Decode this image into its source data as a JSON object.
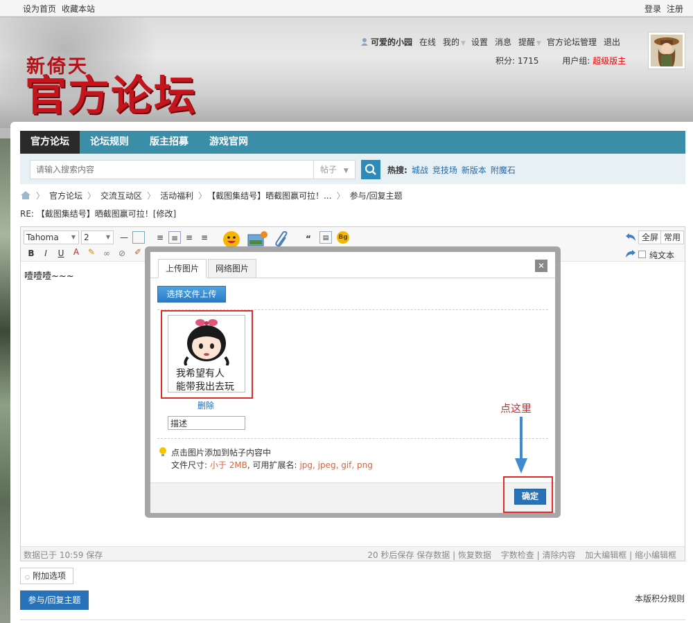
{
  "topbar": {
    "set_home": "设为首页",
    "bookmark": "收藏本站",
    "login": "登录",
    "register": "注册"
  },
  "logo": {
    "small": "新倚天",
    "big": "官方论坛"
  },
  "user": {
    "name": "可爱的小园",
    "status": "在线",
    "mine": "我的",
    "settings": "设置",
    "messages": "消息",
    "reminders": "提醒",
    "admin": "官方论坛管理",
    "logout": "退出",
    "points_label": "积分: 1715",
    "group_label": "用户组:",
    "group_value": "超级版主"
  },
  "nav": {
    "items": [
      "官方论坛",
      "论坛规则",
      "版主招募",
      "游戏官网"
    ]
  },
  "search": {
    "placeholder": "请输入搜索内容",
    "type": "帖子",
    "hot_label": "热搜:",
    "hot_words": [
      "城战",
      "竞技场",
      "新版本",
      "附魔石"
    ]
  },
  "breadcrumb": [
    "官方论坛",
    "交流互动区",
    "活动福利",
    "【截图集结号】晒截图赢可拉！...",
    "参与/回复主题"
  ],
  "post_title": "RE: 【截图集结号】晒截图赢可拉！[修改]",
  "editor": {
    "font": "Tahoma",
    "size": "2",
    "fullscreen": "全屏",
    "common": "常用",
    "plain_text": "纯文本",
    "content": "噎噎噎~~~",
    "footer_left": "数据已于 10:59 保存",
    "footer_right": [
      "20 秒后保存",
      "保存数据",
      "恢复数据",
      "字数检查",
      "清除内容",
      "加大编辑框",
      "缩小编辑框"
    ]
  },
  "extra_options": "附加选项",
  "submit": "参与/回复主题",
  "rules": "本版积分规则",
  "modal": {
    "tabs": [
      "上传图片",
      "网络图片"
    ],
    "upload_btn": "选择文件上传",
    "image_caption_1": "我希望有人",
    "image_caption_2": "能带我出去玩",
    "delete": "删除",
    "desc_value": "描述",
    "tip_line1": "点击图片添加到帖子内容中",
    "tip_size_label": "文件尺寸:",
    "tip_size_value": "小于 2MB",
    "tip_ext_label": ", 可用扩展名:",
    "tip_ext_value": "jpg, jpeg, gif, png",
    "confirm": "确定",
    "annotation": "点这里"
  },
  "colors": {
    "nav": "#3a8ea8",
    "nav_active": "#2a2a2a",
    "accent_red": "#e02a2a",
    "link": "#2469a8",
    "button_blue": "#2872b7"
  }
}
